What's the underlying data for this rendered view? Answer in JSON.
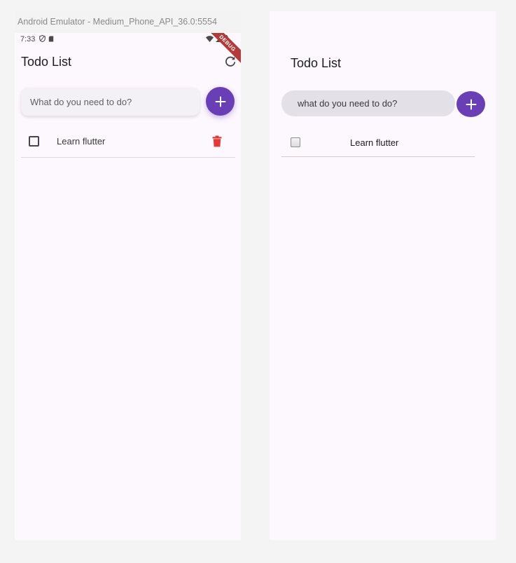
{
  "emulator": {
    "window_title": "Android Emulator - Medium_Phone_API_36.0:5554",
    "status_bar": {
      "time": "7:33",
      "debug_banner": "DEBUG"
    },
    "app_bar": {
      "title": "Todo List",
      "refresh_icon": "refresh-icon"
    },
    "input": {
      "placeholder": "What do you need to do?",
      "value": ""
    },
    "add_button_icon": "plus-icon",
    "todos": [
      {
        "label": "Learn flutter",
        "checked": false,
        "delete_icon": "trash-icon"
      }
    ],
    "colors": {
      "background": "#fdf7fe",
      "accent": "#6a3fb5",
      "delete": "#e53935",
      "debug_banner": "#b13b3b"
    }
  },
  "web": {
    "app_bar": {
      "title": "Todo List"
    },
    "input": {
      "placeholder": "what do you need to do?",
      "value": ""
    },
    "add_button_icon": "plus-icon",
    "todos": [
      {
        "label": "Learn flutter",
        "checked": false
      }
    ],
    "colors": {
      "background": "#fdf7fe",
      "accent": "#6a3fb5",
      "input_bg": "#e3e0e8"
    }
  }
}
